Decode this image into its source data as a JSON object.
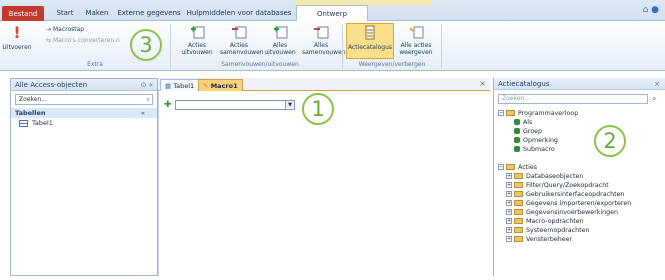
{
  "ribbon": {
    "tabs": [
      "Bestand",
      "Start",
      "Maken",
      "Externe gegevens",
      "Hulpmiddelen voor databases",
      "Ontwerp"
    ],
    "extra_group": {
      "run_label": "Uitvoeren",
      "step_label": "Macrostap",
      "convert_label": "Macro's converteren n",
      "group_label": "Extra"
    },
    "collapse_group": {
      "buttons": [
        "Acties uitvouwen",
        "Acties samenvouwen",
        "Alles uitvouwen",
        "Alles samenvouwen"
      ],
      "group_label": "Samenvouwen/uitvouwen"
    },
    "show_group": {
      "buttons": [
        "Actiecatalogus",
        "Alle acties weergeven"
      ],
      "group_label": "Weergeven/verbergen"
    }
  },
  "nav": {
    "title": "Alle Access-objecten",
    "search_placeholder": "Zoeken...",
    "section": "Tabellen",
    "items": [
      "Tabel1"
    ]
  },
  "document": {
    "tabs": [
      "Tabel1",
      "Macro1"
    ]
  },
  "catalog": {
    "title": "Actiecatalogus",
    "search_placeholder": "Zoeken...",
    "flow_label": "Programmaverloop",
    "flow_items": [
      "Als",
      "Groep",
      "Opmerking",
      "Submacro"
    ],
    "actions_label": "Acties",
    "action_folders": [
      "Databaseobjecten",
      "Filter/Query/Zoekopdracht",
      "Gebruikersinterfaceopdrachten",
      "Gegevens importeren/exporteren",
      "Gegevensinvoerbewerkingen",
      "Macro-opdrachten",
      "Systeemopdrachten",
      "Vensterbeheer"
    ]
  },
  "callouts": [
    "1",
    "2",
    "3"
  ],
  "colors": {
    "file_tab": "#c23a2e",
    "active_doc_tab": "#f9d27a",
    "callout": "#8bc34a"
  }
}
